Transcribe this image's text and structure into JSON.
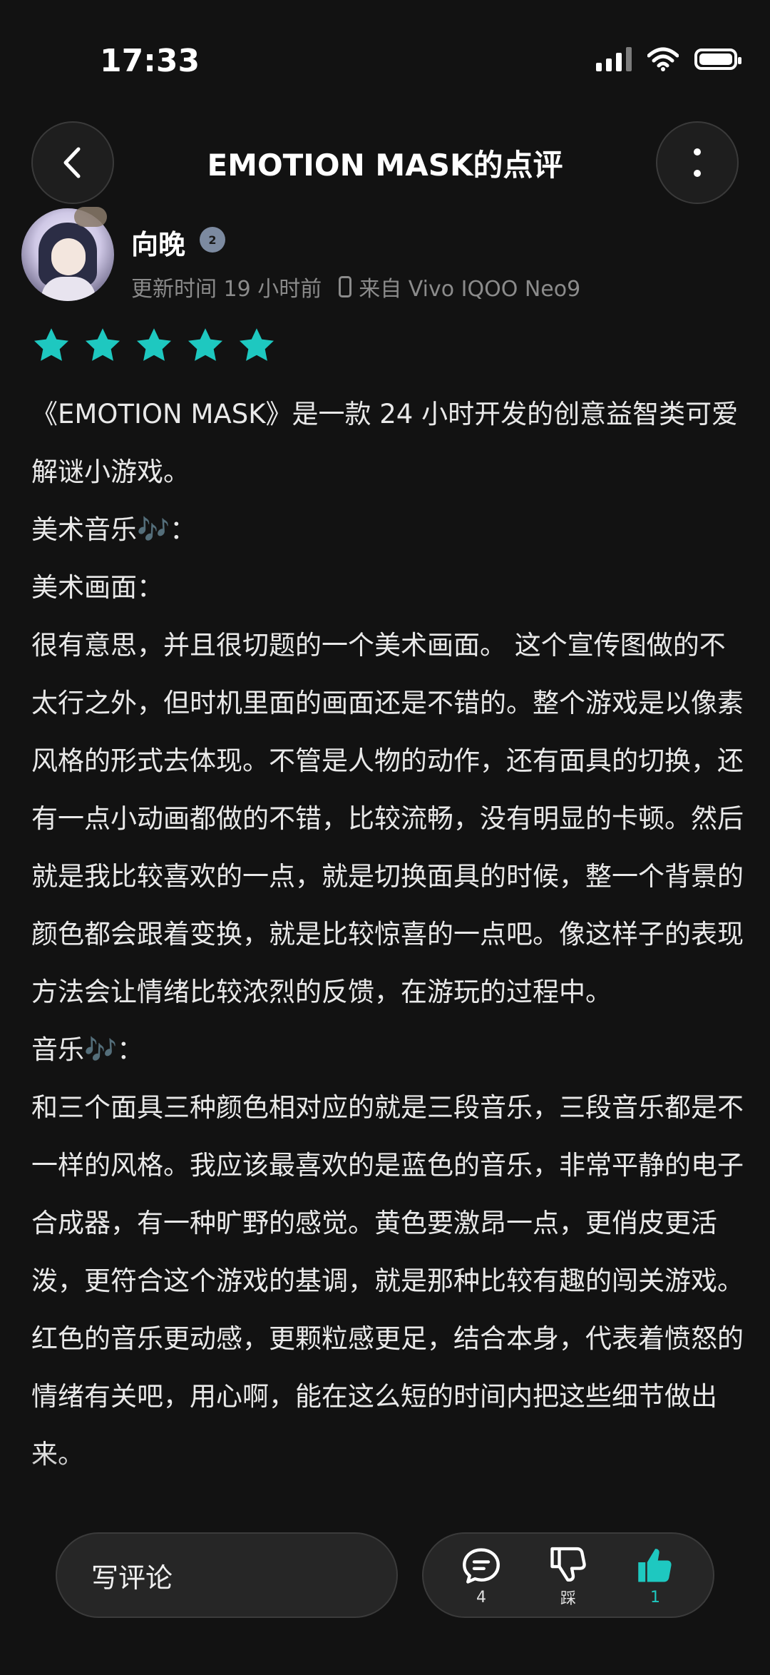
{
  "status_bar": {
    "time": "17:33"
  },
  "header": {
    "title": "EMOTION MASK的点评"
  },
  "review": {
    "author": "向晚",
    "level_badge": "2",
    "updated": "更新时间 19 小时前",
    "device": "来自 Vivo IQOO Neo9",
    "rating": 5,
    "paragraphs": [
      "《EMOTION MASK》是一款 24 小时开发的创意益智类可爱解谜小游戏。",
      "美术音乐🎶：",
      "美术画面：",
      "很有意思，并且很切题的一个美术画面。 这个宣传图做的不太行之外，但时机里面的画面还是不错的。整个游戏是以像素风格的形式去体现。不管是人物的动作，还有面具的切换，还有一点小动画都做的不错，比较流畅，没有明显的卡顿。然后就是我比较喜欢的一点，就是切换面具的时候，整一个背景的颜色都会跟着变换，就是比较惊喜的一点吧。像这样子的表现方法会让情绪比较浓烈的反馈，在游玩的过程中。",
      "音乐🎶：",
      "和三个面具三种颜色相对应的就是三段音乐，三段音乐都是不一样的风格。我应该最喜欢的是蓝色的音乐，非常平静的电子合成器，有一种旷野的感觉。黄色要激昂一点，更俏皮更活泼，更符合这个游戏的基调，就是那种比较有趣的闯关游戏。红色的音乐更动感，更颗粒感更足，结合本身，代表着愤怒的情绪有关吧，用心啊，能在这么短的时间内把这些细节做出来。"
    ]
  },
  "bottom_bar": {
    "write_label": "写评论",
    "comment_count": "4",
    "dislike_label": "踩",
    "like_count": "1"
  },
  "colors": {
    "accent": "#1ec8c0",
    "background": "#121212"
  }
}
